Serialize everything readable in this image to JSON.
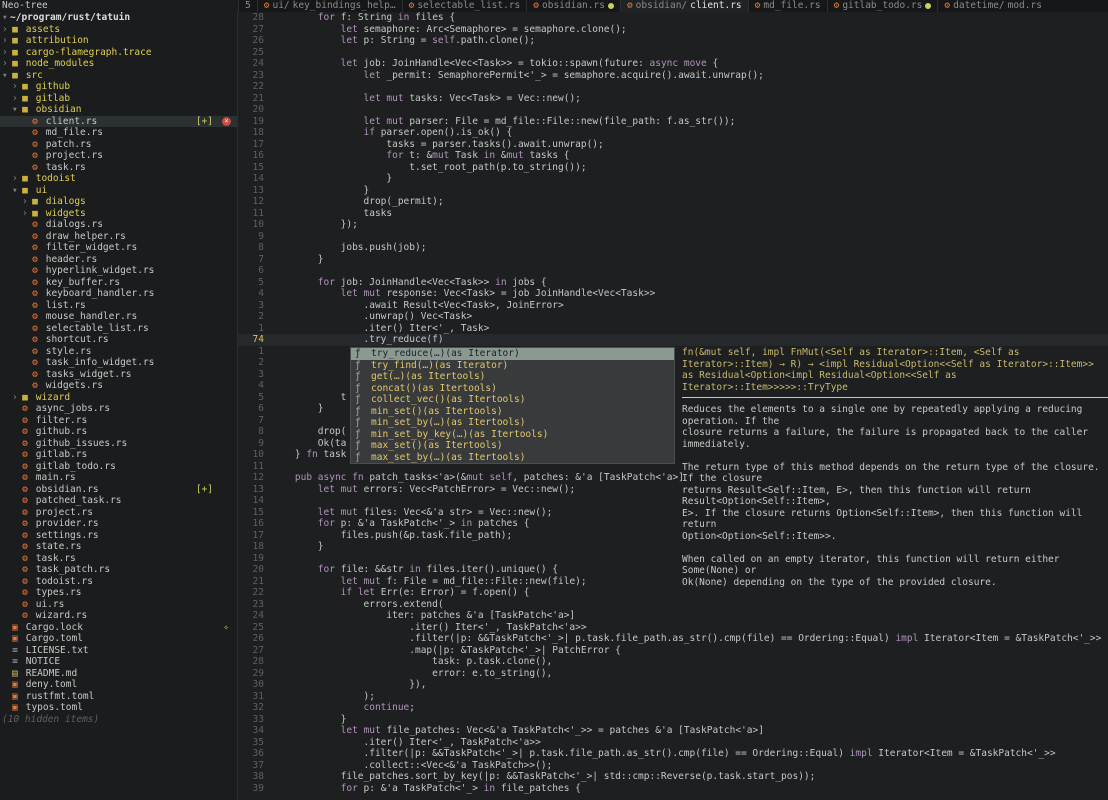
{
  "tabline": {
    "tree_title": "Neo-tree",
    "tab_count": "5",
    "tabs": [
      {
        "dir": "ui/",
        "name": "key_bindings_help…",
        "modified": false,
        "active": false
      },
      {
        "dir": "",
        "name": "selectable_list.rs",
        "modified": false,
        "active": false
      },
      {
        "dir": "",
        "name": "obsidian.rs",
        "modified": true,
        "active": false
      },
      {
        "dir": "obsidian/",
        "name": "client.rs",
        "modified": false,
        "active": true
      },
      {
        "dir": "",
        "name": "md_file.rs",
        "modified": false,
        "active": false
      },
      {
        "dir": "",
        "name": "gitlab_todo.rs",
        "modified": true,
        "active": false
      },
      {
        "dir": "datetime/",
        "name": "mod.rs",
        "modified": false,
        "active": false
      }
    ]
  },
  "tree": {
    "rows": [
      {
        "indent": 0,
        "kind": "root",
        "label": "~/program/rust/tatuin"
      },
      {
        "indent": 0,
        "kind": "dir",
        "label": "assets"
      },
      {
        "indent": 0,
        "kind": "dir",
        "label": "attribution"
      },
      {
        "indent": 0,
        "kind": "dir",
        "label": "cargo-flamegraph.trace"
      },
      {
        "indent": 0,
        "kind": "dir",
        "label": "node_modules"
      },
      {
        "indent": 0,
        "kind": "dir-open",
        "label": "src"
      },
      {
        "indent": 1,
        "kind": "dir",
        "label": "github"
      },
      {
        "indent": 1,
        "kind": "dir",
        "label": "gitlab"
      },
      {
        "indent": 1,
        "kind": "dir-open",
        "label": "obsidian"
      },
      {
        "indent": 2,
        "kind": "rs",
        "label": "client.rs",
        "badge": "[+]",
        "close": true,
        "selected": true
      },
      {
        "indent": 2,
        "kind": "rs",
        "label": "md_file.rs"
      },
      {
        "indent": 2,
        "kind": "rs",
        "label": "patch.rs"
      },
      {
        "indent": 2,
        "kind": "rs",
        "label": "project.rs"
      },
      {
        "indent": 2,
        "kind": "rs",
        "label": "task.rs"
      },
      {
        "indent": 1,
        "kind": "dir",
        "label": "todoist"
      },
      {
        "indent": 1,
        "kind": "dir-open",
        "label": "ui"
      },
      {
        "indent": 2,
        "kind": "dir",
        "label": "dialogs"
      },
      {
        "indent": 2,
        "kind": "dir",
        "label": "widgets"
      },
      {
        "indent": 2,
        "kind": "rs",
        "label": "dialogs.rs"
      },
      {
        "indent": 2,
        "kind": "rs",
        "label": "draw_helper.rs"
      },
      {
        "indent": 2,
        "kind": "rs",
        "label": "filter_widget.rs"
      },
      {
        "indent": 2,
        "kind": "rs",
        "label": "header.rs"
      },
      {
        "indent": 2,
        "kind": "rs",
        "label": "hyperlink_widget.rs"
      },
      {
        "indent": 2,
        "kind": "rs",
        "label": "key_buffer.rs"
      },
      {
        "indent": 2,
        "kind": "rs",
        "label": "keyboard_handler.rs"
      },
      {
        "indent": 2,
        "kind": "rs",
        "label": "list.rs"
      },
      {
        "indent": 2,
        "kind": "rs",
        "label": "mouse_handler.rs"
      },
      {
        "indent": 2,
        "kind": "rs",
        "label": "selectable_list.rs"
      },
      {
        "indent": 2,
        "kind": "rs",
        "label": "shortcut.rs"
      },
      {
        "indent": 2,
        "kind": "rs",
        "label": "style.rs"
      },
      {
        "indent": 2,
        "kind": "rs",
        "label": "task_info_widget.rs"
      },
      {
        "indent": 2,
        "kind": "rs",
        "label": "tasks_widget.rs"
      },
      {
        "indent": 2,
        "kind": "rs",
        "label": "widgets.rs"
      },
      {
        "indent": 1,
        "kind": "dir",
        "label": "wizard"
      },
      {
        "indent": 1,
        "kind": "rs",
        "label": "async_jobs.rs"
      },
      {
        "indent": 1,
        "kind": "rs",
        "label": "filter.rs"
      },
      {
        "indent": 1,
        "kind": "rs",
        "label": "github.rs"
      },
      {
        "indent": 1,
        "kind": "rs",
        "label": "github_issues.rs"
      },
      {
        "indent": 1,
        "kind": "rs",
        "label": "gitlab.rs"
      },
      {
        "indent": 1,
        "kind": "rs",
        "label": "gitlab_todo.rs"
      },
      {
        "indent": 1,
        "kind": "rs",
        "label": "main.rs"
      },
      {
        "indent": 1,
        "kind": "rs",
        "label": "obsidian.rs",
        "badge": "[+]"
      },
      {
        "indent": 1,
        "kind": "rs",
        "label": "patched_task.rs"
      },
      {
        "indent": 1,
        "kind": "rs",
        "label": "project.rs"
      },
      {
        "indent": 1,
        "kind": "rs",
        "label": "provider.rs"
      },
      {
        "indent": 1,
        "kind": "rs",
        "label": "settings.rs"
      },
      {
        "indent": 1,
        "kind": "rs",
        "label": "state.rs"
      },
      {
        "indent": 1,
        "kind": "rs",
        "label": "task.rs"
      },
      {
        "indent": 1,
        "kind": "rs",
        "label": "task_patch.rs"
      },
      {
        "indent": 1,
        "kind": "rs",
        "label": "todoist.rs"
      },
      {
        "indent": 1,
        "kind": "rs",
        "label": "types.rs"
      },
      {
        "indent": 1,
        "kind": "rs",
        "label": "ui.rs"
      },
      {
        "indent": 1,
        "kind": "rs",
        "label": "wizard.rs"
      },
      {
        "indent": 0,
        "kind": "toml",
        "label": "Cargo.lock",
        "lock": true
      },
      {
        "indent": 0,
        "kind": "toml",
        "label": "Cargo.toml"
      },
      {
        "indent": 0,
        "kind": "gen",
        "label": "LICENSE.txt"
      },
      {
        "indent": 0,
        "kind": "gen",
        "label": "NOTICE"
      },
      {
        "indent": 0,
        "kind": "md",
        "label": "README.md"
      },
      {
        "indent": 0,
        "kind": "toml",
        "label": "deny.toml"
      },
      {
        "indent": 0,
        "kind": "toml",
        "label": "rustfmt.toml"
      },
      {
        "indent": 0,
        "kind": "toml",
        "label": "typos.toml"
      },
      {
        "indent": 0,
        "kind": "hidden",
        "label": "(10 hidden items)"
      }
    ]
  },
  "editor": {
    "lines": [
      {
        "n": "28",
        "text": "        for f: String in files {"
      },
      {
        "n": "27",
        "text": "            let semaphore: Arc<Semaphore> = semaphore.clone();"
      },
      {
        "n": "26",
        "text": "            let p: String = self.path.clone();"
      },
      {
        "n": "25",
        "text": ""
      },
      {
        "n": "24",
        "text": "            let job: JoinHandle<Vec<Task>> = tokio::spawn(future: async move {"
      },
      {
        "n": "23",
        "text": "                let _permit: SemaphorePermit<'_> = semaphore.acquire().await.unwrap();"
      },
      {
        "n": "22",
        "text": ""
      },
      {
        "n": "21",
        "text": "                let mut tasks: Vec<Task> = Vec::new();"
      },
      {
        "n": "20",
        "text": ""
      },
      {
        "n": "19",
        "text": "                let mut parser: File = md_file::File::new(file_path: f.as_str());"
      },
      {
        "n": "18",
        "text": "                if parser.open().is_ok() {"
      },
      {
        "n": "17",
        "text": "                    tasks = parser.tasks().await.unwrap();"
      },
      {
        "n": "16",
        "text": "                    for t: &mut Task in &mut tasks {"
      },
      {
        "n": "15",
        "text": "                        t.set_root_path(p.to_string());"
      },
      {
        "n": "14",
        "text": "                    }"
      },
      {
        "n": "13",
        "text": "                }"
      },
      {
        "n": "12",
        "text": "                drop(_permit);"
      },
      {
        "n": "11",
        "text": "                tasks"
      },
      {
        "n": "10",
        "text": "            });"
      },
      {
        "n": "9",
        "text": ""
      },
      {
        "n": "8",
        "text": "            jobs.push(job);"
      },
      {
        "n": "7",
        "text": "        }"
      },
      {
        "n": "6",
        "text": ""
      },
      {
        "n": "5",
        "text": "        for job: JoinHandle<Vec<Task>> in jobs {"
      },
      {
        "n": "4",
        "text": "            let mut response: Vec<Task> = job JoinHandle<Vec<Task>>"
      },
      {
        "n": "3",
        "text": "                .await Result<Vec<Task>, JoinError>"
      },
      {
        "n": "2",
        "text": "                .unwrap() Vec<Task>"
      },
      {
        "n": "1",
        "text": "                .iter() Iter<'_, Task>"
      },
      {
        "n": "74",
        "text": "                .try_reduce(f)",
        "cursor": true
      },
      {
        "n": "1",
        "text": ""
      },
      {
        "n": "2",
        "text": ""
      },
      {
        "n": "3",
        "text": ""
      },
      {
        "n": "4",
        "text": ""
      },
      {
        "n": "5",
        "text": "            t"
      },
      {
        "n": "6",
        "text": "        }"
      },
      {
        "n": "7",
        "text": ""
      },
      {
        "n": "8",
        "text": "        drop("
      },
      {
        "n": "9",
        "text": "        Ok(ta"
      },
      {
        "n": "10",
        "text": "    } fn task"
      },
      {
        "n": "11",
        "text": ""
      },
      {
        "n": "12",
        "text": "    pub async fn patch_tasks<'a>(&mut self, patches: &'a [TaskPatch<'a>]) -"
      },
      {
        "n": "13",
        "text": "        let mut errors: Vec<PatchError> = Vec::new();"
      },
      {
        "n": "14",
        "text": ""
      },
      {
        "n": "15",
        "text": "        let mut files: Vec<&'a str> = Vec::new();"
      },
      {
        "n": "16",
        "text": "        for p: &'a TaskPatch<'_> in patches {"
      },
      {
        "n": "17",
        "text": "            files.push(&p.task.file_path);"
      },
      {
        "n": "18",
        "text": "        }"
      },
      {
        "n": "19",
        "text": ""
      },
      {
        "n": "20",
        "text": "        for file: &&str in files.iter().unique() {"
      },
      {
        "n": "21",
        "text": "            let mut f: File = md_file::File::new(file);"
      },
      {
        "n": "22",
        "text": "            if let Err(e: Error) = f.open() {"
      },
      {
        "n": "23",
        "text": "                errors.extend("
      },
      {
        "n": "24",
        "text": "                    iter: patches &'a [TaskPatch<'a>]"
      },
      {
        "n": "25",
        "text": "                        .iter() Iter<'_, TaskPatch<'a>>"
      },
      {
        "n": "26",
        "text": "                        .filter(|p: &&TaskPatch<'_>| p.task.file_path.as_str().cmp(file) == Ordering::Equal) impl Iterator<Item = &TaskPatch<'_>>"
      },
      {
        "n": "27",
        "text": "                        .map(|p: &TaskPatch<'_>| PatchError {"
      },
      {
        "n": "28",
        "text": "                            task: p.task.clone(),"
      },
      {
        "n": "29",
        "text": "                            error: e.to_string(),"
      },
      {
        "n": "30",
        "text": "                        }),"
      },
      {
        "n": "31",
        "text": "                );"
      },
      {
        "n": "32",
        "text": "                continue;"
      },
      {
        "n": "33",
        "text": "            }"
      },
      {
        "n": "34",
        "text": "            let mut file_patches: Vec<&'a TaskPatch<'_>> = patches &'a [TaskPatch<'a>]"
      },
      {
        "n": "35",
        "text": "                .iter() Iter<'_, TaskPatch<'a>>"
      },
      {
        "n": "36",
        "text": "                .filter(|p: &&TaskPatch<'_>| p.task.file_path.as_str().cmp(file) == Ordering::Equal) impl Iterator<Item = &TaskPatch<'_>>"
      },
      {
        "n": "37",
        "text": "                .collect::<Vec<&'a TaskPatch>>();"
      },
      {
        "n": "38",
        "text": "            file_patches.sort_by_key(|p: &&TaskPatch<'_>| std::cmp::Reverse(p.task.start_pos));"
      },
      {
        "n": "39",
        "text": "            for p: &'a TaskPatch<'_> in file_patches {"
      }
    ]
  },
  "completion": {
    "kind_glyph": "ƒ",
    "items": [
      {
        "label": "try_reduce(…)(as Iterator)",
        "selected": true
      },
      {
        "label": "try_find(…)(as Iterator)"
      },
      {
        "label": "get(…)(as Itertools)"
      },
      {
        "label": "concat()(as Itertools)"
      },
      {
        "label": "collect_vec()(as Itertools)"
      },
      {
        "label": "min_set()(as Itertools)"
      },
      {
        "label": "min_set_by(…)(as Itertools)"
      },
      {
        "label": "min_set_by_key(…)(as Itertools)"
      },
      {
        "label": "max_set()(as Itertools)"
      },
      {
        "label": "max_set_by(…)(as Itertools)"
      }
    ]
  },
  "docs": {
    "signature": "fn(&mut self, impl FnMut(<Self as Iterator>::Item, <Self as Iterator>::Item) → R) → <impl Residual<Option<<Self as Iterator>::Item>> as Residual<Option<impl Residual<Option<<Self as Iterator>::Item>>>>>::TryType",
    "paragraphs": [
      "Reduces the elements to a single one by repeatedly applying a reducing operation. If the\nclosure returns a failure, the failure is propagated back to the caller immediately.",
      "The return type of this method depends on the return type of the closure. If the closure\nreturns Result<Self::Item, E>, then this function will return Result<Option<Self::Item>,\nE>. If the closure returns Option<Self::Item>, then this function will return\nOption<Option<Self::Item>>.",
      "When called on an empty iterator, this function will return either Some(None) or\nOk(None) depending on the type of the provided closure."
    ]
  },
  "colors": {
    "background": "#1d1f21",
    "folder": "#dfd04a",
    "rust_icon": "#e8773a",
    "cursor_line_number": "#e8c05a",
    "selected_completion": "#8a9a93",
    "close_badge": "#cc4b44"
  }
}
